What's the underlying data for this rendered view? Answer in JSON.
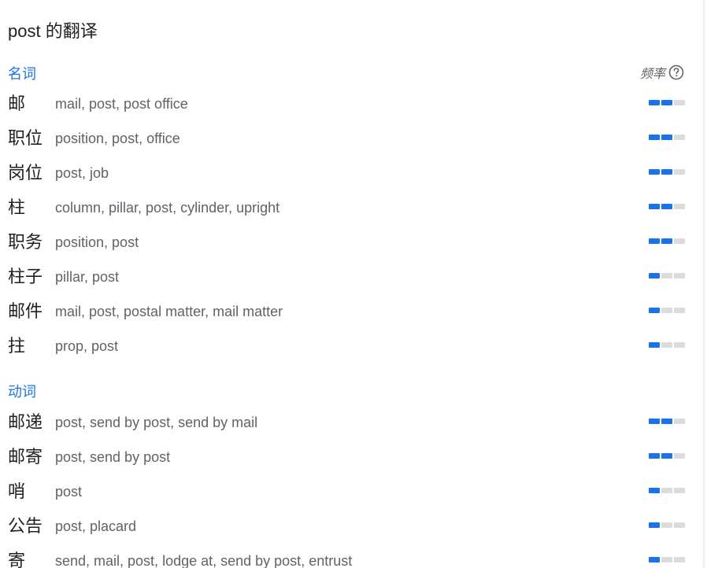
{
  "title": "post 的翻译",
  "frequency_label": "频率",
  "colors": {
    "section": "#1a73e8",
    "bar_on": "#1a73e8",
    "bar_off": "#dadce0"
  },
  "sections": [
    {
      "label": "名词",
      "entries": [
        {
          "term": "邮",
          "meanings": "mail, post, post office",
          "frequency": 2
        },
        {
          "term": "职位",
          "meanings": "position, post, office",
          "frequency": 2
        },
        {
          "term": "岗位",
          "meanings": "post, job",
          "frequency": 2
        },
        {
          "term": "柱",
          "meanings": "column, pillar, post, cylinder, upright",
          "frequency": 2
        },
        {
          "term": "职务",
          "meanings": "position, post",
          "frequency": 2
        },
        {
          "term": "柱子",
          "meanings": "pillar, post",
          "frequency": 1
        },
        {
          "term": "邮件",
          "meanings": "mail, post, postal matter, mail matter",
          "frequency": 1
        },
        {
          "term": "拄",
          "meanings": "prop, post",
          "frequency": 1
        }
      ]
    },
    {
      "label": "动词",
      "entries": [
        {
          "term": "邮递",
          "meanings": "post, send by post, send by mail",
          "frequency": 2
        },
        {
          "term": "邮寄",
          "meanings": "post, send by post",
          "frequency": 2
        },
        {
          "term": "哨",
          "meanings": "post",
          "frequency": 1
        },
        {
          "term": "公告",
          "meanings": "post, placard",
          "frequency": 1
        },
        {
          "term": "寄",
          "meanings": "send, mail, post, lodge at, send by post, entrust",
          "frequency": 1
        }
      ]
    }
  ]
}
